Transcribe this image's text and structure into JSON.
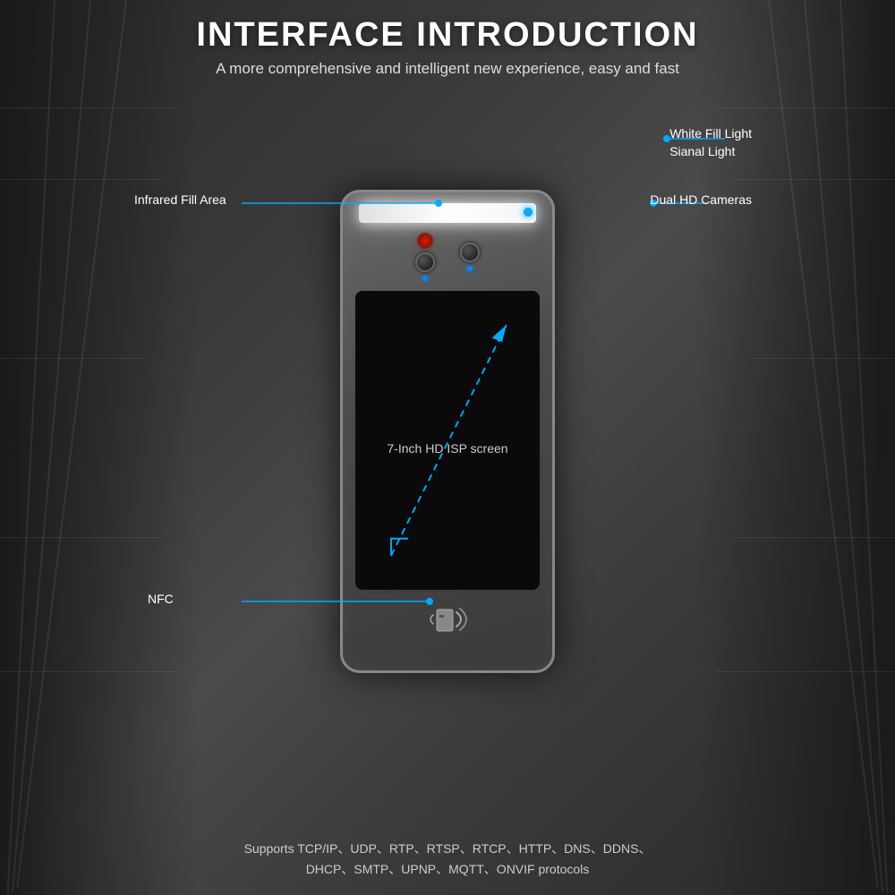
{
  "page": {
    "title": "INTERFACE INTRODUCTION",
    "subtitle": "A more comprehensive and intelligent new experience, easy and fast"
  },
  "annotations": {
    "white_fill_light": "White Fill Light",
    "signal_light": "Sianal Light",
    "infrared_fill": "Infrared Fill Area",
    "dual_cameras": "Dual HD Cameras",
    "screen_label": "7-Inch HD ISP screen",
    "nfc": "NFC"
  },
  "protocols": {
    "line1": "Supports TCP/IP、UDP、RTP、RTSP、RTCP、HTTP、DNS、DDNS、",
    "line2": "DHCP、SMTP、UPNP、MQTT、ONVIF protocols"
  },
  "colors": {
    "accent": "#00aaff",
    "title": "#ffffff",
    "subtitle": "#dddddd",
    "label": "#ffffff"
  }
}
